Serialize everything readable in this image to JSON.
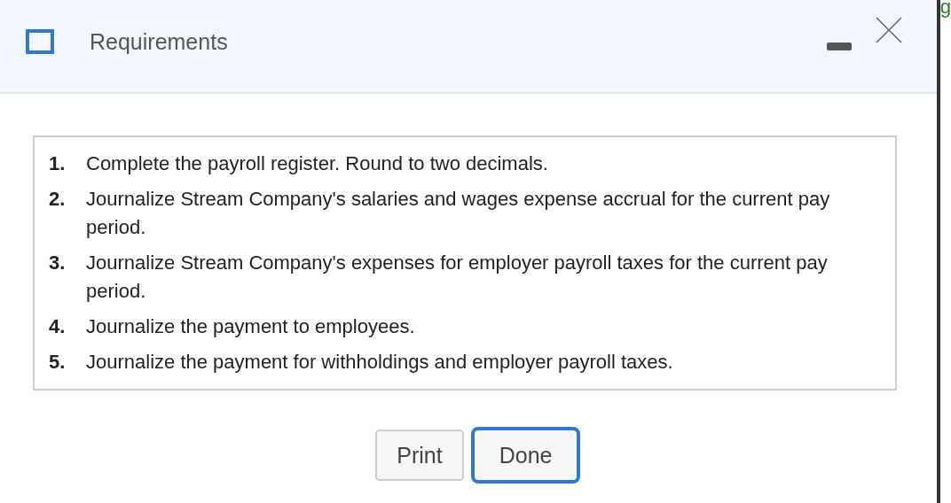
{
  "dialog": {
    "title": "Requirements"
  },
  "requirements": [
    {
      "number": "1.",
      "text": "Complete the payroll register. Round to two decimals."
    },
    {
      "number": "2.",
      "text": "Journalize Stream Company's salaries and wages expense accrual for the current pay period."
    },
    {
      "number": "3.",
      "text": "Journalize Stream Company's expenses for employer payroll taxes for the current pay period."
    },
    {
      "number": "4.",
      "text": "Journalize the payment to employees."
    },
    {
      "number": "5.",
      "text": "Journalize the payment for withholdings and employer payroll taxes."
    }
  ],
  "buttons": [
    {
      "label": "Print",
      "focused": false
    },
    {
      "label": "Done",
      "focused": true
    }
  ],
  "background": {
    "text": "g"
  }
}
